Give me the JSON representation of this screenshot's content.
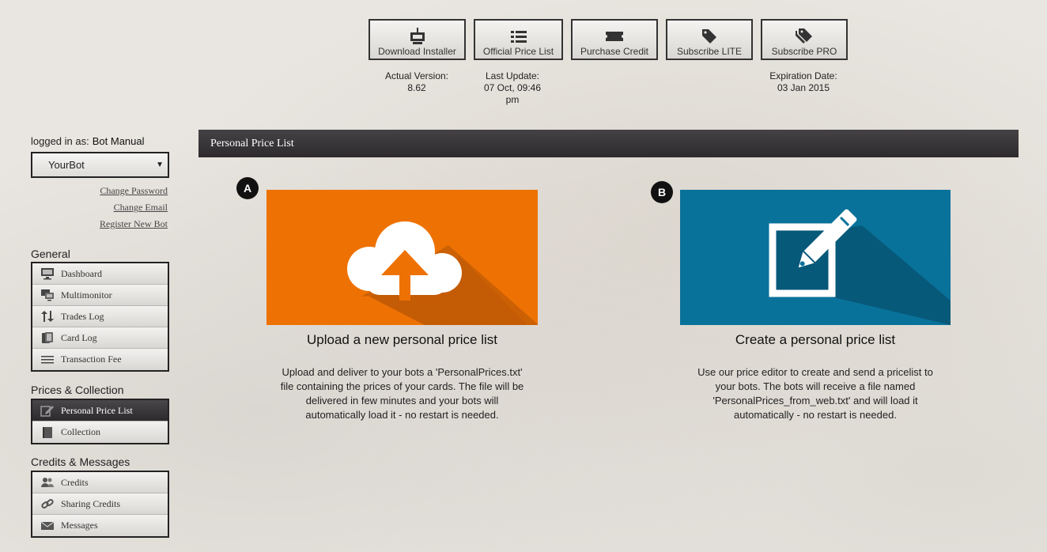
{
  "toolbar": {
    "download_installer": "Download Installer",
    "official_price_list": "Official Price List",
    "purchase_credit": "Purchase Credit",
    "subscribe_lite": "Subscribe LITE",
    "subscribe_pro": "Subscribe PRO"
  },
  "info": {
    "actual_version_label": "Actual Version:",
    "actual_version_value": "8.62",
    "last_update_label": "Last Update:",
    "last_update_value_1": "07 Oct, 09:46",
    "last_update_value_2": "pm",
    "expiration_label": "Expiration Date:",
    "expiration_value": "03 Jan 2015"
  },
  "account": {
    "logged_in_label": "logged in as:",
    "user_name": "Bot Manual",
    "selected_bot": "YourBot",
    "change_password": "Change Password",
    "change_email": "Change Email",
    "register_new_bot": "Register New Bot"
  },
  "sidebar": {
    "general_title": "General",
    "general_items": [
      "Dashboard",
      "Multimonitor",
      "Trades Log",
      "Card Log",
      "Transaction Fee"
    ],
    "prices_title": "Prices & Collection",
    "prices_items": [
      "Personal Price List",
      "Collection"
    ],
    "credits_title": "Credits & Messages",
    "credits_items": [
      "Credits",
      "Sharing Credits",
      "Messages"
    ]
  },
  "panel": {
    "title": "Personal Price List",
    "badge_a": "A",
    "badge_b": "B",
    "option_a_title": "Upload a new personal price list",
    "option_a_desc_1": "Upload and deliver to your bots a 'PersonalPrices.txt'",
    "option_a_desc_2": "file containing the prices of your cards. The file will be",
    "option_a_desc_3": "delivered in few minutes and your bots will",
    "option_a_desc_4": "automatically load it - no restart is needed.",
    "option_b_title": "Create a personal price list",
    "option_b_desc_1": "Use our price editor to create and send a pricelist to",
    "option_b_desc_2": "your bots. The bots will receive a file named",
    "option_b_desc_3": "'PersonalPrices_from_web.txt' and will load it",
    "option_b_desc_4": "automatically - no restart is needed."
  },
  "colors": {
    "orange_tile": "#ee7203",
    "blue_tile": "#09729a",
    "header_dark": "#3a373a"
  }
}
